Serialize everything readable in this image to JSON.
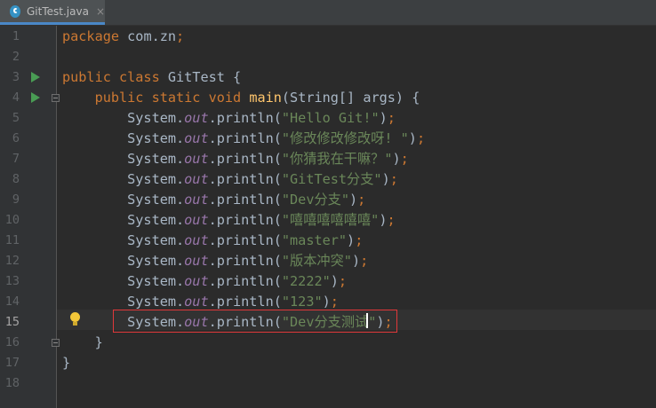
{
  "tab": {
    "label": "GitTest.java",
    "close": "×"
  },
  "editor": {
    "current_line": 15,
    "lines": [
      {
        "num": "1",
        "tokens": [
          [
            "kw",
            "package"
          ],
          [
            "plain",
            " com.zn"
          ],
          [
            "kw",
            ";"
          ]
        ]
      },
      {
        "num": "2",
        "tokens": []
      },
      {
        "num": "3",
        "tokens": [
          [
            "kw",
            "public class"
          ],
          [
            "plain",
            " GitTest {"
          ]
        ]
      },
      {
        "num": "4",
        "tokens": [
          [
            "plain",
            "    "
          ],
          [
            "kw",
            "public static void"
          ],
          [
            "plain",
            " "
          ],
          [
            "fn",
            "main"
          ],
          [
            "plain",
            "(String[] args) {"
          ]
        ]
      },
      {
        "num": "5",
        "tokens": [
          [
            "plain",
            "        System."
          ],
          [
            "fld",
            "out"
          ],
          [
            "plain",
            ".println("
          ],
          [
            "str",
            "\"Hello Git!\""
          ],
          [
            "plain",
            ")"
          ],
          [
            "kw",
            ";"
          ]
        ]
      },
      {
        "num": "6",
        "tokens": [
          [
            "plain",
            "        System."
          ],
          [
            "fld",
            "out"
          ],
          [
            "plain",
            ".println("
          ],
          [
            "str",
            "\"修改修改修改呀! \""
          ],
          [
            "plain",
            ")"
          ],
          [
            "kw",
            ";"
          ]
        ]
      },
      {
        "num": "7",
        "tokens": [
          [
            "plain",
            "        System."
          ],
          [
            "fld",
            "out"
          ],
          [
            "plain",
            ".println("
          ],
          [
            "str",
            "\"你猜我在干嘛？\""
          ],
          [
            "plain",
            ")"
          ],
          [
            "kw",
            ";"
          ]
        ]
      },
      {
        "num": "8",
        "tokens": [
          [
            "plain",
            "        System."
          ],
          [
            "fld",
            "out"
          ],
          [
            "plain",
            ".println("
          ],
          [
            "str",
            "\"GitTest分支\""
          ],
          [
            "plain",
            ")"
          ],
          [
            "kw",
            ";"
          ]
        ]
      },
      {
        "num": "9",
        "tokens": [
          [
            "plain",
            "        System."
          ],
          [
            "fld",
            "out"
          ],
          [
            "plain",
            ".println("
          ],
          [
            "str",
            "\"Dev分支\""
          ],
          [
            "plain",
            ")"
          ],
          [
            "kw",
            ";"
          ]
        ]
      },
      {
        "num": "10",
        "tokens": [
          [
            "plain",
            "        System."
          ],
          [
            "fld",
            "out"
          ],
          [
            "plain",
            ".println("
          ],
          [
            "str",
            "\"嘻嘻嘻嘻嘻嘻\""
          ],
          [
            "plain",
            ")"
          ],
          [
            "kw",
            ";"
          ]
        ]
      },
      {
        "num": "11",
        "tokens": [
          [
            "plain",
            "        System."
          ],
          [
            "fld",
            "out"
          ],
          [
            "plain",
            ".println("
          ],
          [
            "str",
            "\"master\""
          ],
          [
            "plain",
            ")"
          ],
          [
            "kw",
            ";"
          ]
        ]
      },
      {
        "num": "12",
        "tokens": [
          [
            "plain",
            "        System."
          ],
          [
            "fld",
            "out"
          ],
          [
            "plain",
            ".println("
          ],
          [
            "str",
            "\"版本冲突\""
          ],
          [
            "plain",
            ")"
          ],
          [
            "kw",
            ";"
          ]
        ]
      },
      {
        "num": "13",
        "tokens": [
          [
            "plain",
            "        System."
          ],
          [
            "fld",
            "out"
          ],
          [
            "plain",
            ".println("
          ],
          [
            "str",
            "\"2222\""
          ],
          [
            "plain",
            ")"
          ],
          [
            "kw",
            ";"
          ]
        ]
      },
      {
        "num": "14",
        "tokens": [
          [
            "plain",
            "        System."
          ],
          [
            "fld",
            "out"
          ],
          [
            "plain",
            ".println("
          ],
          [
            "str",
            "\"123\""
          ],
          [
            "plain",
            ")"
          ],
          [
            "kw",
            ";"
          ]
        ]
      },
      {
        "num": "15",
        "tokens": [
          [
            "plain",
            "        System."
          ],
          [
            "fld",
            "out"
          ],
          [
            "plain",
            ".println("
          ],
          [
            "str",
            "\"Dev分支测试\""
          ],
          [
            "plain",
            ")"
          ],
          [
            "kw",
            ";"
          ]
        ]
      },
      {
        "num": "16",
        "tokens": [
          [
            "plain",
            "    }"
          ]
        ]
      },
      {
        "num": "17",
        "tokens": [
          [
            "plain",
            "}"
          ]
        ]
      },
      {
        "num": "18",
        "tokens": []
      }
    ]
  },
  "gutter_icons": {
    "run_lines": [
      3,
      4
    ],
    "fold_lines": [
      4,
      16
    ],
    "bulb_line": 15
  },
  "colors": {
    "background": "#2b2b2b",
    "keyword": "#cc7832",
    "string": "#6a8759",
    "method": "#ffc66d",
    "field": "#9876aa",
    "highlight_box": "#e0383a"
  }
}
